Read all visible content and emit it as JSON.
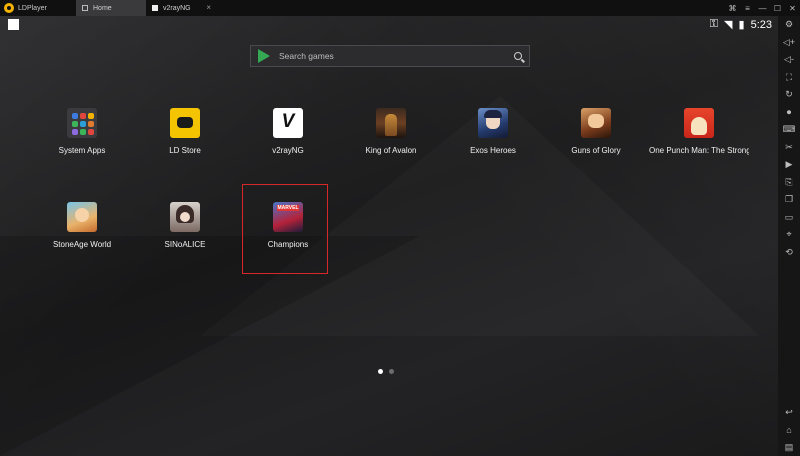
{
  "titlebar": {
    "brand": "LDPlayer",
    "tabs": [
      {
        "label": "Home",
        "icon": "home-icon",
        "active": true
      },
      {
        "label": "v2rayNG",
        "icon": "v2rayng-icon",
        "active": false,
        "close": "×"
      }
    ],
    "controls": [
      {
        "name": "gamepad-icon",
        "glyph": "⌘"
      },
      {
        "name": "menu-icon",
        "glyph": "≡"
      },
      {
        "name": "minimize-icon",
        "glyph": "—"
      },
      {
        "name": "maximize-icon",
        "glyph": "☐"
      },
      {
        "name": "close-icon",
        "glyph": "✕"
      }
    ]
  },
  "status": {
    "time": "5:23",
    "icons": {
      "key": "⚿",
      "wifi": "◥",
      "battery": "▮"
    }
  },
  "search": {
    "placeholder": "Search games"
  },
  "apps": [
    {
      "label": "System Apps"
    },
    {
      "label": "LD Store"
    },
    {
      "label": "v2rayNG"
    },
    {
      "label": "King of Avalon"
    },
    {
      "label": "Exos Heroes"
    },
    {
      "label": "Guns of Glory"
    },
    {
      "label": "One Punch Man: The Stronge…"
    },
    {
      "label": "StoneAge World"
    },
    {
      "label": "SINoALICE"
    },
    {
      "label": "Champions",
      "icon_text": "MARVEL",
      "highlighted": true
    }
  ],
  "page_indicator": {
    "pages": 2,
    "current": 1
  },
  "sidebar": {
    "top": [
      "settings-icon",
      "volume-up-icon",
      "volume-down-icon",
      "resize-icon",
      "sync-icon",
      "record-icon",
      "keyboard-icon",
      "scissors-icon",
      "video-icon",
      "screenshot-icon",
      "multi-instance-icon",
      "folder-icon",
      "location-icon",
      "rotate-icon"
    ],
    "top_glyphs": [
      "⚙",
      "◁+",
      "◁-",
      "⛶",
      "↻",
      "⏺",
      "⌨",
      "✂",
      "▶",
      "⎘",
      "❐",
      "▭",
      "⌖",
      "⟲"
    ],
    "bottom": [
      "back-icon",
      "home-nav-icon",
      "recent-apps-icon"
    ],
    "bottom_glyphs": [
      "↩",
      "⌂",
      "▤"
    ]
  }
}
